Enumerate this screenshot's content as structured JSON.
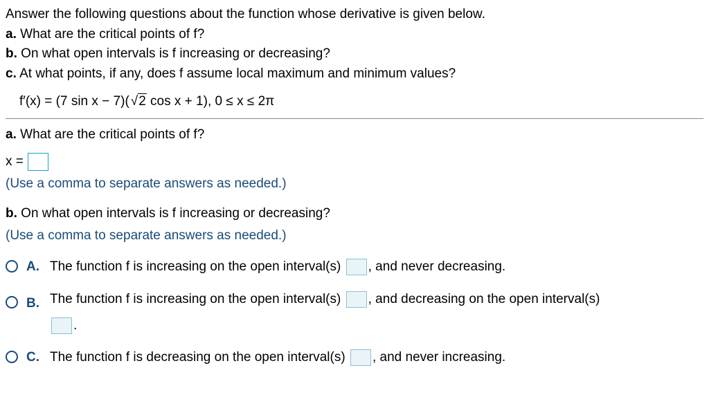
{
  "intro": "Answer the following questions about the function whose derivative is given below.",
  "parts_intro": {
    "a": {
      "label": "a.",
      "text": "What are the critical points of f?"
    },
    "b": {
      "label": "b.",
      "text": "On what open intervals is f increasing or decreasing?"
    },
    "c": {
      "label": "c.",
      "text": "At what points, if any, does f assume local maximum and minimum values?"
    }
  },
  "equation": {
    "lhs": "f′(x) = (7 sin x − 7)",
    "sqrt_inner": "2",
    "after_sqrt": " cos x + 1",
    "domain": ", 0 ≤ x ≤ 2π"
  },
  "question_a": {
    "label": "a.",
    "text": "What are the critical points of f?",
    "answer_label": "x =",
    "hint": "(Use a comma to separate answers as needed.)"
  },
  "question_b": {
    "label": "b.",
    "text": "On what open intervals is f increasing or decreasing?",
    "hint": "(Use a comma to separate answers as needed.)",
    "choices": {
      "A": {
        "letter": "A.",
        "pre": "The function f is increasing on the open interval(s) ",
        "post": ", and never decreasing."
      },
      "B": {
        "letter": "B.",
        "pre": "The function f is increasing on the open interval(s) ",
        "mid": ", and decreasing on the open interval(s)",
        "post": "."
      },
      "C": {
        "letter": "C.",
        "pre": "The function f is decreasing on the open interval(s) ",
        "post": ", and never increasing."
      }
    }
  }
}
